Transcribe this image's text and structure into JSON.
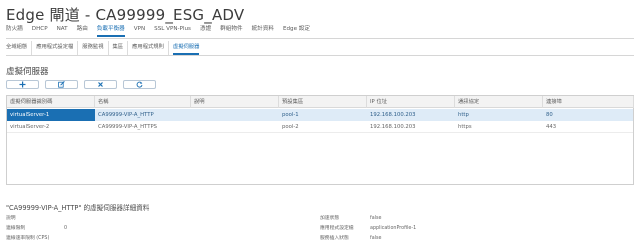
{
  "page": {
    "title": "Edge 閘道 - CA99999_ESG_ADV"
  },
  "main_tabs": [
    {
      "label": "防火牆"
    },
    {
      "label": "DHCP"
    },
    {
      "label": "NAT"
    },
    {
      "label": "路由"
    },
    {
      "label": "負載平衡器",
      "active": true
    },
    {
      "label": "VPN"
    },
    {
      "label": "SSL VPN-Plus"
    },
    {
      "label": "憑證"
    },
    {
      "label": "群組物件"
    },
    {
      "label": "統計資料"
    },
    {
      "label": "Edge 設定"
    }
  ],
  "sub_tabs": [
    {
      "label": "全域組態"
    },
    {
      "label": "應用程式設定檔"
    },
    {
      "label": "服務監視"
    },
    {
      "label": "集區"
    },
    {
      "label": "應用程式規則"
    },
    {
      "label": "虛擬伺服器",
      "active": true
    }
  ],
  "section": {
    "title": "虛擬伺服器"
  },
  "toolbar": {
    "add_icon": "plus-icon",
    "edit_icon": "edit-icon",
    "delete_icon": "close-icon",
    "refresh_icon": "refresh-icon",
    "accent_color": "#1a6fb3"
  },
  "table": {
    "columns": [
      "虛擬伺服器識別碼",
      "名稱",
      "說明",
      "預設集區",
      "IP 位址",
      "通訊協定",
      "連接埠"
    ],
    "rows": [
      {
        "id": "virtualServer-1",
        "name": "CA99999-VIP-A_HTTP",
        "description": "",
        "pool": "pool-1",
        "ip": "192.168.100.203",
        "protocol": "http",
        "port": "80",
        "selected": true
      },
      {
        "id": "virtualServer-2",
        "name": "CA99999-VIP-A_HTTPS",
        "description": "",
        "pool": "pool-2",
        "ip": "192.168.100.203",
        "protocol": "https",
        "port": "443",
        "selected": false
      }
    ],
    "selected_row_color": "#deebf7",
    "selected_cell_color": "#1a6fb3"
  },
  "details": {
    "title": "\"CA99999-VIP-A_HTTP\" 的虛擬伺服器詳細資料",
    "left": [
      {
        "label": "說明",
        "value": ""
      },
      {
        "label": "連線限制",
        "value": "0"
      },
      {
        "label": "連線速率限制 (CPS)",
        "value": ""
      }
    ],
    "right": [
      {
        "label": "加速狀態",
        "value": "false"
      },
      {
        "label": "應用程式設定檔",
        "value": "applicationProfile-1"
      },
      {
        "label": "服務插入狀態",
        "value": "false"
      }
    ]
  }
}
